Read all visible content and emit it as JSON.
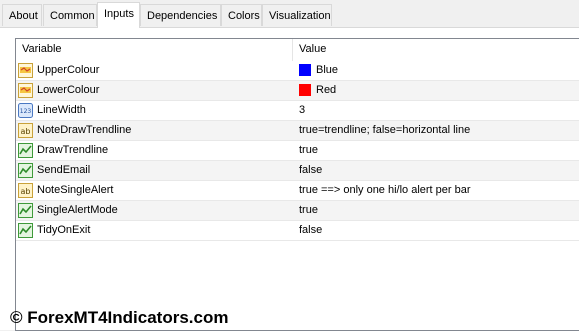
{
  "tabs": [
    {
      "label": "About",
      "active": false
    },
    {
      "label": "Common",
      "active": false
    },
    {
      "label": "Inputs",
      "active": true
    },
    {
      "label": "Dependencies",
      "active": false
    },
    {
      "label": "Colors",
      "active": false
    },
    {
      "label": "Visualization",
      "active": false
    }
  ],
  "grid": {
    "header_variable": "Variable",
    "header_value": "Value",
    "rows": [
      {
        "icon": "color-param-icon",
        "name": "UpperColour",
        "value": "Blue",
        "swatch": "#0000ff"
      },
      {
        "icon": "color-param-icon",
        "name": "LowerColour",
        "value": "Red",
        "swatch": "#ff0000"
      },
      {
        "icon": "integer-param-icon",
        "name": "LineWidth",
        "value": "3"
      },
      {
        "icon": "string-param-icon",
        "name": "NoteDrawTrendline",
        "value": "true=trendline; false=horizontal line"
      },
      {
        "icon": "bool-param-icon",
        "name": "DrawTrendline",
        "value": "true"
      },
      {
        "icon": "bool-param-icon",
        "name": "SendEmail",
        "value": "false"
      },
      {
        "icon": "string-param-icon",
        "name": "NoteSingleAlert",
        "value": "true ==> only one hi/lo alert per bar"
      },
      {
        "icon": "bool-param-icon",
        "name": "SingleAlertMode",
        "value": "true"
      },
      {
        "icon": "bool-param-icon",
        "name": "TidyOnExit",
        "value": "false"
      }
    ]
  },
  "watermark": "© ForexMT4Indicators.com"
}
